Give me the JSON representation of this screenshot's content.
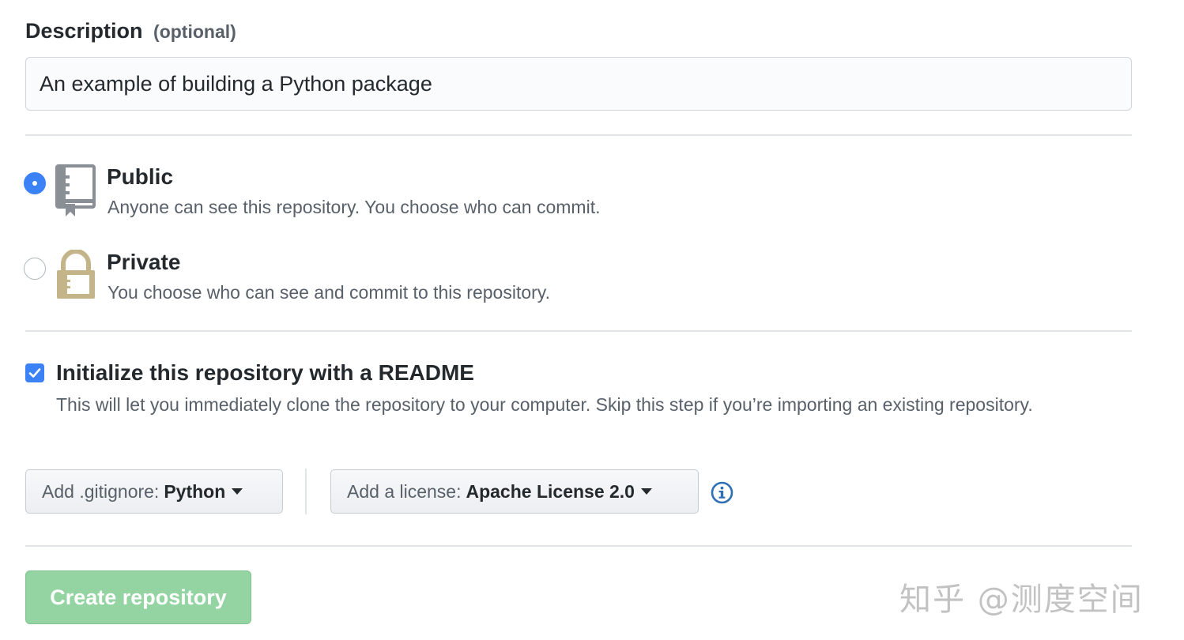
{
  "description": {
    "label": "Description",
    "optional": "(optional)",
    "value": "An example of building a Python package"
  },
  "visibility": {
    "public": {
      "title": "Public",
      "description": "Anyone can see this repository. You choose who can commit.",
      "icon": "repo-book-icon",
      "selected": true
    },
    "private": {
      "title": "Private",
      "description": "You choose who can see and commit to this repository.",
      "icon": "lock-icon",
      "selected": false
    }
  },
  "readme": {
    "checked": true,
    "title": "Initialize this repository with a README",
    "description": "This will let you immediately clone the repository to your computer. Skip this step if you’re importing an existing repository."
  },
  "gitignore": {
    "label": "Add .gitignore:",
    "value": "Python"
  },
  "license": {
    "label": "Add a license:",
    "value": "Apache License 2.0"
  },
  "create_button": {
    "label": "Create repository"
  },
  "watermark": {
    "text": "知乎 @测度空间"
  },
  "colors": {
    "accent_blue": "#3b82f6",
    "create_green": "#94d3a2",
    "lock_tan": "#c4b48a",
    "text_muted": "#586069"
  }
}
